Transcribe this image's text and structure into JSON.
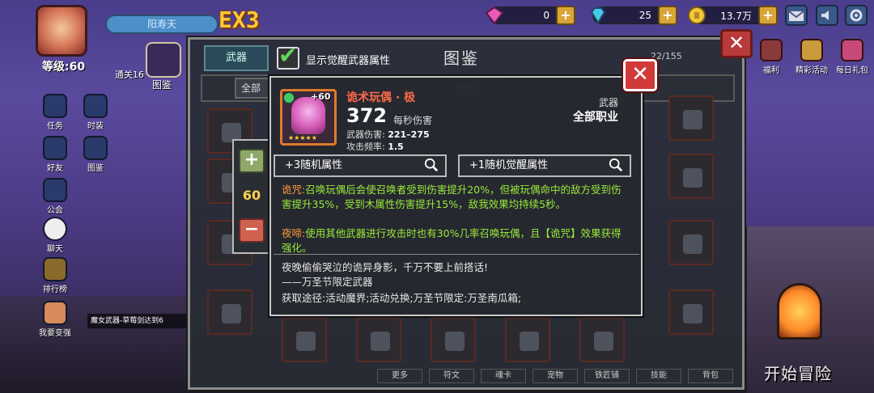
{
  "player": {
    "name": "阳寿天",
    "level_label": "等级:60",
    "ex_badge": "EX3",
    "clear_tag": "通关16"
  },
  "resources": [
    {
      "name": "gem-pink",
      "value": "0",
      "color": "#e85ab8"
    },
    {
      "name": "diamond",
      "value": "25",
      "color": "#4ac8e8"
    },
    {
      "name": "gold-coin",
      "value": "13.7万",
      "color": "#f2c83a"
    }
  ],
  "sidebar": {
    "tujian": "图鉴",
    "items": [
      {
        "label": "任务",
        "icon": "task-icon"
      },
      {
        "label": "时装",
        "icon": "fashion-icon"
      },
      {
        "label": "好友",
        "icon": "friends-icon"
      },
      {
        "label": "图鉴",
        "icon": "codex-icon"
      },
      {
        "label": "公会",
        "icon": "guild-icon"
      },
      {
        "label": "聊天",
        "icon": "chat-icon"
      },
      {
        "label": "排行榜",
        "icon": "ranking-icon"
      },
      {
        "label": "我要变强",
        "icon": "power-up-icon"
      }
    ]
  },
  "ticker": "魔女武器-草莓剑达到6",
  "codex": {
    "title": "图鉴",
    "tab_weapons": "武器",
    "awaken_toggle_label": "显示觉醒武器属性",
    "awaken_checked": true,
    "count": "22/155",
    "filters": [
      "全部",
      "全部"
    ]
  },
  "level_selector": {
    "plus": "+",
    "minus": "−",
    "value": "60"
  },
  "weapon": {
    "name": "诡术玩偶 · 极",
    "level_badge": "+60",
    "stars": "★★★★★",
    "type": "武器",
    "class": "全部职业",
    "dps": "372",
    "dps_label": "每秒伤害",
    "damage_label": "武器伤害:",
    "damage_value": "221–275",
    "rate_label": "攻击频率:",
    "rate_value": "1.5",
    "random_attr": "+3随机属性",
    "awaken_attr": "+1随机觉醒属性",
    "skill1_tag": "诡咒:",
    "skill1_text": "召唤玩偶后会使召唤者受到伤害提升20%，但被玩偶命中的敌方受到伤害提升35%，受到木属性伤害提升15%，敌我效果均持续5秒。",
    "skill2_tag": "夜啼:",
    "skill2_text": "使用其他武器进行攻击时也有30%几率召唤玩偶，且【诡咒】效果获得强化。",
    "flavor1": "夜晚偷偷哭泣的诡异身影，千万不要上前搭话!",
    "flavor2": "——万圣节限定武器",
    "source": "获取途径:活动魔界;活动兑换;万圣节限定:万圣南瓜箱;"
  },
  "right_menu": [
    {
      "label": "福利",
      "icon": "gift-box-icon"
    },
    {
      "label": "精彩活动",
      "icon": "activity-icon"
    },
    {
      "label": "每日礼包",
      "icon": "daily-gift-icon"
    }
  ],
  "bottom_tabs": [
    "更多",
    "符文",
    "魂卡",
    "宠物",
    "铁匠铺",
    "技能",
    "背包"
  ],
  "start_button": "开始冒险",
  "colors": {
    "accent_red": "#d23a3a",
    "skill_green": "#9aea3a",
    "skill_tag_orange": "#ff9a3a",
    "weapon_name": "#ff6a4a"
  }
}
